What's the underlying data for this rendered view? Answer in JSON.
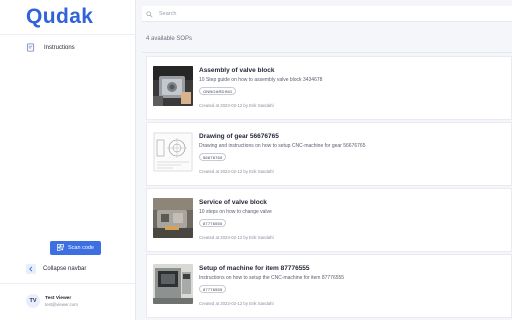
{
  "sidebar": {
    "logo": "Qudak",
    "nav_items": [
      {
        "label": "Instructions",
        "icon": "document-icon"
      }
    ],
    "scan_button": {
      "label": "Scan code",
      "icon": "qr-code-icon"
    },
    "collapse": {
      "label": "Collapse navbar",
      "icon": "chevron-left-icon"
    },
    "user": {
      "initials": "TV",
      "name": "Test Viewer",
      "email": "test@viewer.com"
    }
  },
  "main": {
    "search": {
      "placeholder": "Search",
      "value": ""
    },
    "count_text": "4 available SOPs",
    "sops": [
      {
        "title": "Assembly of valve block",
        "description": "10 Step guide on how to assembly valve block 3434678",
        "tag": "ONBOARDING",
        "created": "Created at 2023-02-12 by Erik Sandahl",
        "thumbnail": "valve-assembly-photo"
      },
      {
        "title": "Drawing of gear 56676765",
        "description": "Drawing and instructions on how to setup CNC-machine for gear 56676765",
        "tag": "56676765",
        "created": "Created at 2023-02-12 by Erik Sandahl",
        "thumbnail": "gear-drawing"
      },
      {
        "title": "Service of valve block",
        "description": "10 steps on how to change valve",
        "tag": "87776555",
        "created": "Created at 2023-02-12 by Erik Sandahl",
        "thumbnail": "valve-service-photo"
      },
      {
        "title": "Setup of machine for item 87776555",
        "description": "Instructions on how to setup the CNC-machine for item 87776555",
        "tag": "87776555",
        "created": "Created at 2023-02-12 by Erik Sandahl",
        "thumbnail": "cnc-machine-photo"
      }
    ]
  },
  "colors": {
    "brand": "#2f63d9",
    "button": "#3d6fe3",
    "background": "#f5f6fa"
  }
}
